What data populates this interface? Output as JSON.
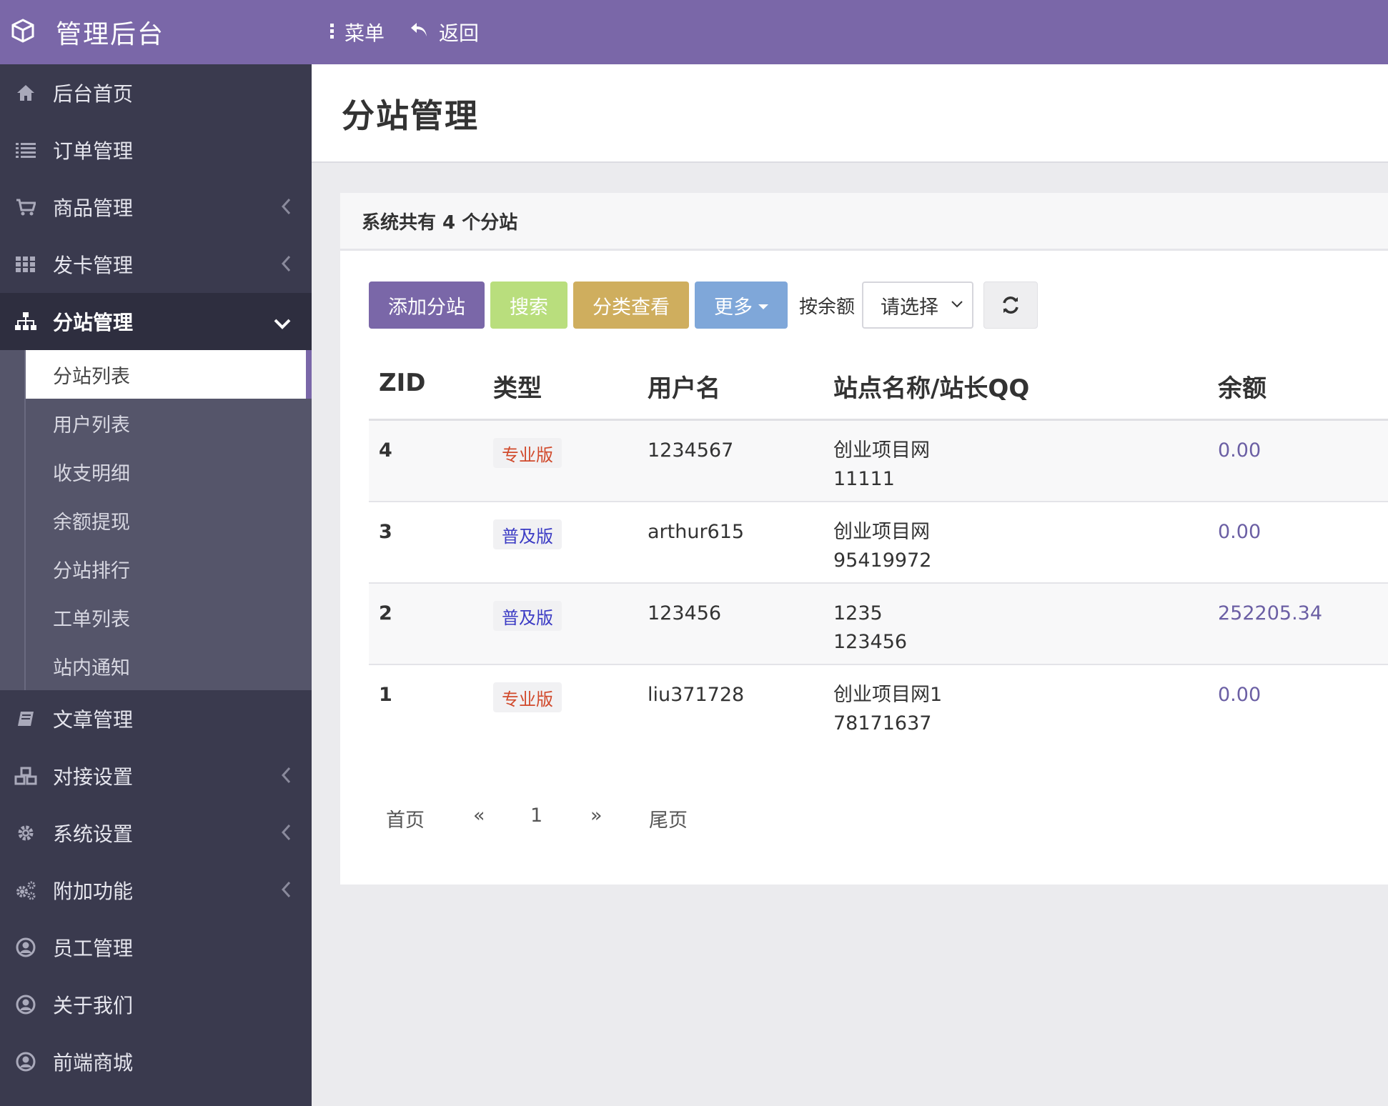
{
  "header": {
    "brand": "管理后台",
    "menu_label": "菜单",
    "back_label": "返回",
    "color": "#7a67a8"
  },
  "sidebar": {
    "items": [
      {
        "label": "后台首页"
      },
      {
        "label": "订单管理"
      },
      {
        "label": "商品管理"
      },
      {
        "label": "发卡管理"
      },
      {
        "label": "分站管理"
      },
      {
        "label": "文章管理"
      },
      {
        "label": "对接设置"
      },
      {
        "label": "系统设置"
      },
      {
        "label": "附加功能"
      },
      {
        "label": "员工管理"
      },
      {
        "label": "关于我们"
      },
      {
        "label": "前端商城"
      }
    ],
    "subitems": [
      {
        "label": "分站列表"
      },
      {
        "label": "用户列表"
      },
      {
        "label": "收支明细"
      },
      {
        "label": "余额提现"
      },
      {
        "label": "分站排行"
      },
      {
        "label": "工单列表"
      },
      {
        "label": "站内通知"
      }
    ]
  },
  "main": {
    "page_title": "分站管理",
    "panel_title": "系统共有 4 个分站",
    "toolbar": {
      "add": "添加分站",
      "search": "搜索",
      "category": "分类查看",
      "more": "更多",
      "sort_label": "按余额",
      "select_value": "请选择"
    },
    "table": {
      "headers": [
        "ZID",
        "类型",
        "用户名",
        "站点名称/站长QQ",
        "余额"
      ],
      "rows": [
        {
          "zid": "4",
          "type": "专业版",
          "type_color": "#d14a2c",
          "username": "1234567",
          "site": "创业项目网",
          "qq": "11111",
          "balance": "0.00"
        },
        {
          "zid": "3",
          "type": "普及版",
          "type_color": "#3b3bc4",
          "username": "arthur615",
          "site": "创业项目网",
          "qq": "95419972",
          "balance": "0.00"
        },
        {
          "zid": "2",
          "type": "普及版",
          "type_color": "#3b3bc4",
          "username": "123456",
          "site": "1235",
          "qq": "123456",
          "balance": "252205.34"
        },
        {
          "zid": "1",
          "type": "专业版",
          "type_color": "#d14a2c",
          "username": "liu371728",
          "site": "创业项目网1",
          "qq": "78171637",
          "balance": "0.00"
        }
      ]
    },
    "pagination": {
      "first": "首页",
      "prev": "«",
      "page": "1",
      "next": "»",
      "last": "尾页"
    }
  }
}
